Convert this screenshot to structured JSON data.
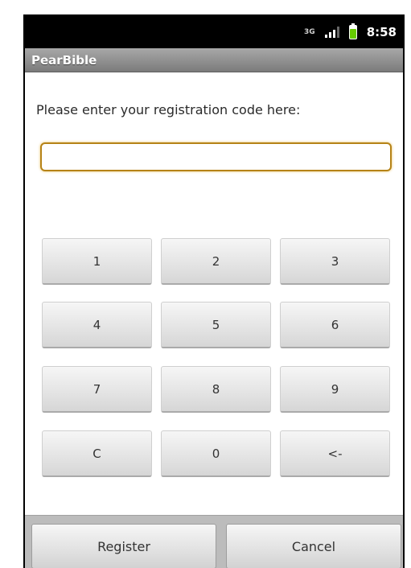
{
  "status_bar": {
    "network_type": "3G",
    "time": "8:58",
    "icons": [
      "network-type-icon",
      "signal-icon",
      "battery-icon"
    ]
  },
  "app": {
    "title": "PearBible"
  },
  "registration": {
    "prompt": "Please enter your registration code here:",
    "code_value": "",
    "code_placeholder": ""
  },
  "keypad": {
    "keys": [
      "1",
      "2",
      "3",
      "4",
      "5",
      "6",
      "7",
      "8",
      "9",
      "C",
      "0",
      "<-"
    ]
  },
  "actions": {
    "register_label": "Register",
    "cancel_label": "Cancel"
  },
  "colors": {
    "input_border": "#b68317",
    "title_bar": "#8f8f8f",
    "battery": "#66cc00"
  }
}
